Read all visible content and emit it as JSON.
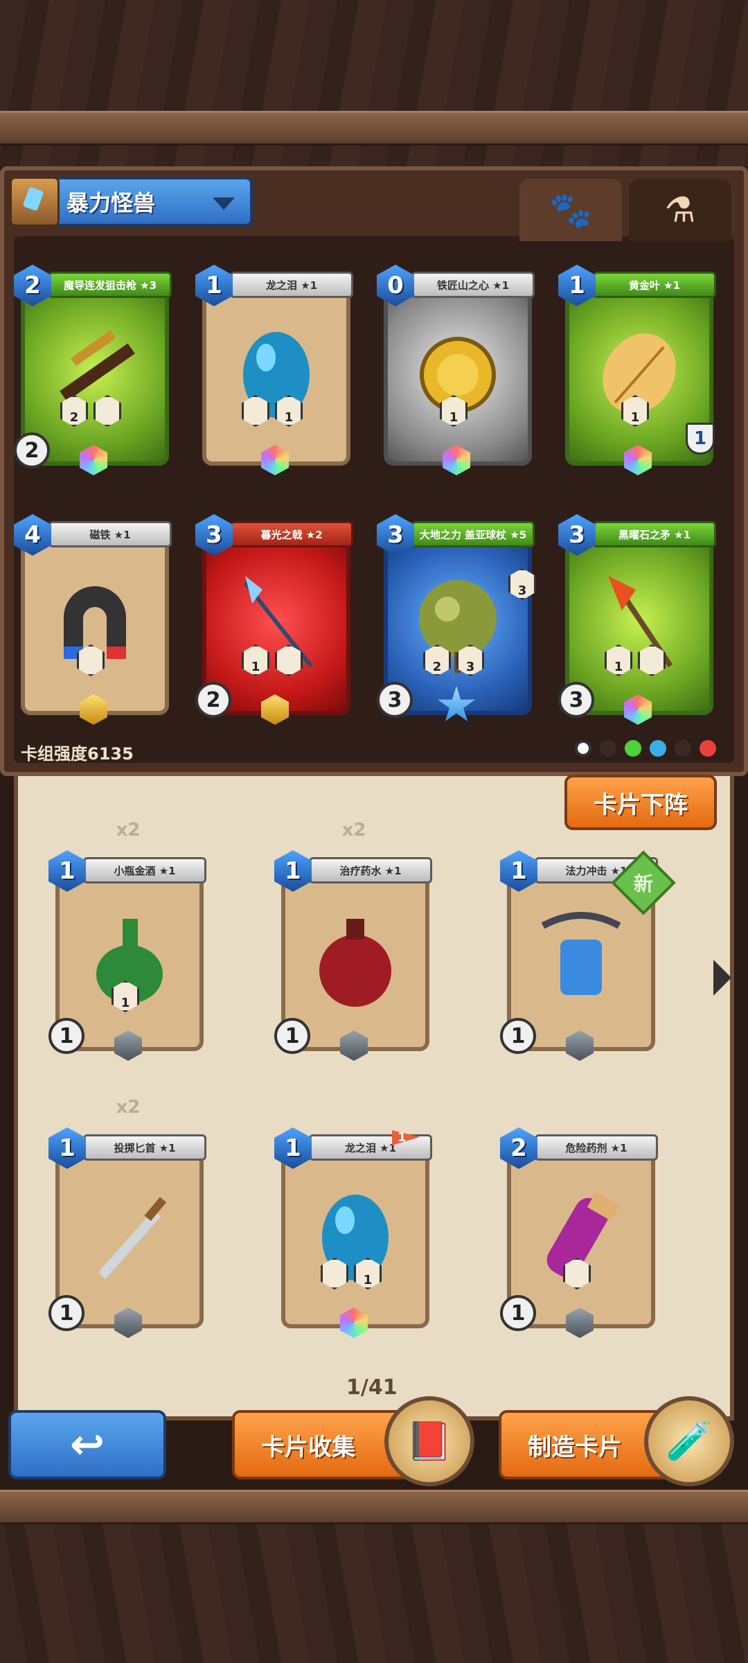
{
  "deck": {
    "name": "暴力怪兽",
    "strength_label": "卡组强度6135",
    "tabs": [
      {
        "icon": "paw-icon"
      },
      {
        "icon": "potion-icon"
      }
    ],
    "cards": [
      {
        "cost": "2",
        "name": "魔导连发狙击枪 ★3",
        "frame": "green",
        "art": "sniper-rifle",
        "left_num": "2",
        "icons": [
          [
            "",
            "2"
          ],
          [
            "",
            ""
          ]
        ],
        "gem": "rainbow"
      },
      {
        "cost": "1",
        "name": "龙之泪 ★1",
        "frame": "beige",
        "art": "dragon-tear-egg",
        "left_num": "",
        "icons": [
          [
            "",
            ""
          ],
          [
            "",
            "1"
          ]
        ],
        "gem": "rainbow"
      },
      {
        "cost": "0",
        "name": "铁匠山之心 ★1",
        "frame": "grey",
        "art": "gold-coin",
        "left_num": "",
        "icons": [
          [
            "",
            "1"
          ]
        ],
        "gem": "rainbow"
      },
      {
        "cost": "1",
        "name": "黄金叶 ★1",
        "frame": "green",
        "art": "golden-leaf",
        "left_num": "",
        "icons": [
          [
            "",
            "1"
          ]
        ],
        "gem": "rainbow",
        "shield_num": "1"
      },
      {
        "cost": "4",
        "name": "磁铁 ★1",
        "frame": "beige",
        "art": "magnet",
        "left_num": "",
        "icons": [
          [
            "",
            ""
          ]
        ],
        "gem": "gold"
      },
      {
        "cost": "3",
        "name": "暮光之戟 ★2",
        "frame": "red",
        "art": "halberd",
        "left_num": "2",
        "icons": [
          [
            "",
            "1"
          ],
          [
            "",
            ""
          ]
        ],
        "gem": "gold"
      },
      {
        "cost": "3",
        "name": "大地之力 盖亚球杖 ★5",
        "frame": "blue",
        "art": "earth-orb",
        "left_num": "3",
        "icons": [
          [
            "",
            "2"
          ],
          [
            "",
            "3"
          ]
        ],
        "gem": "star",
        "side_num": "3"
      },
      {
        "cost": "3",
        "name": "黑曜石之矛 ★1",
        "frame": "green",
        "art": "obsidian-spear",
        "left_num": "3",
        "icons": [
          [
            "",
            "1"
          ],
          [
            "",
            ""
          ]
        ],
        "gem": "rainbow"
      }
    ]
  },
  "remove_button": "卡片下阵",
  "collection": {
    "cards": [
      {
        "cost": "1",
        "name": "小瓶金酒 ★1",
        "copies": "x2",
        "art": "green-potion",
        "left_num": "1",
        "icons": [
          [
            "",
            "1"
          ]
        ],
        "gem": "grey"
      },
      {
        "cost": "1",
        "name": "治疗药水 ★1",
        "copies": "x2",
        "art": "red-potion",
        "left_num": "1",
        "icons": [],
        "gem": "grey"
      },
      {
        "cost": "1",
        "name": "法力冲击 ★1",
        "copies": "",
        "art": "mana-blast",
        "left_num": "1",
        "icons": [],
        "gem": "grey",
        "badge": "新"
      },
      {
        "cost": "1",
        "name": "投掷匕首 ★1",
        "copies": "x2",
        "art": "dagger",
        "left_num": "1",
        "icons": [],
        "gem": "grey"
      },
      {
        "cost": "1",
        "name": "龙之泪 ★1",
        "copies": "",
        "art": "dragon-tear-egg",
        "left_num": "",
        "icons": [
          [
            "",
            ""
          ],
          [
            "",
            "1"
          ]
        ],
        "gem": "rainbow",
        "flag": "1"
      },
      {
        "cost": "2",
        "name": "危险药剂 ★1",
        "copies": "",
        "art": "purple-vial",
        "left_num": "1",
        "icons": [
          [
            "",
            ""
          ]
        ],
        "gem": "grey"
      }
    ],
    "page": "1/41"
  },
  "bottom": {
    "back_icon": "back-arrow-icon",
    "collect_label": "卡片收集",
    "craft_label": "制造卡片"
  },
  "colors": {
    "accent_orange": "#e46a10",
    "accent_blue": "#2f6fc5",
    "wood_dark": "#2a1a14"
  }
}
